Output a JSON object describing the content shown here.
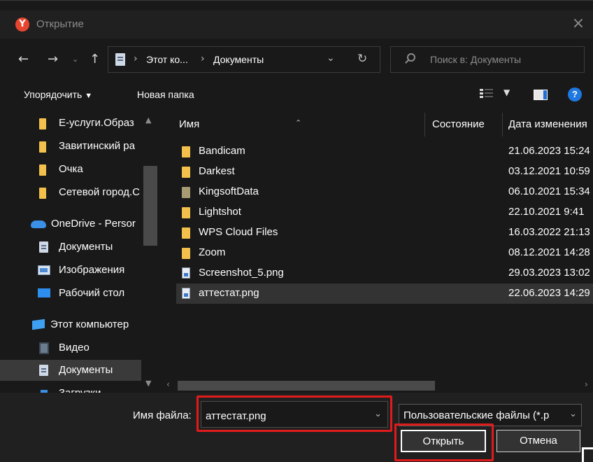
{
  "window": {
    "title": "Открытие",
    "app_icon": "yandex-browser-icon"
  },
  "address": {
    "crumbs": [
      "Этот ко...",
      "Документы"
    ]
  },
  "search": {
    "placeholder": "Поиск в: Документы"
  },
  "toolbar": {
    "organize_label": "Упорядочить",
    "new_folder_label": "Новая папка"
  },
  "sidebar": {
    "items": [
      {
        "label": "Е-услуги.Образ",
        "icon": "folder"
      },
      {
        "label": "Завитинский ра",
        "icon": "folder"
      },
      {
        "label": "Очка",
        "icon": "folder"
      },
      {
        "label": "Сетевой город.С",
        "icon": "folder"
      },
      {
        "label": "OneDrive - Persor",
        "icon": "onedrive"
      },
      {
        "label": "Документы",
        "icon": "documents"
      },
      {
        "label": "Изображения",
        "icon": "pictures"
      },
      {
        "label": "Рабочий стол",
        "icon": "desktop"
      },
      {
        "label": "Этот компьютер",
        "icon": "computer"
      },
      {
        "label": "Видео",
        "icon": "video"
      },
      {
        "label": "Документы",
        "icon": "documents",
        "selected": true
      },
      {
        "label": "Загрузки",
        "icon": "downloads"
      }
    ]
  },
  "columns": {
    "name": "Имя",
    "status": "Состояние",
    "date": "Дата изменения"
  },
  "files": [
    {
      "name": "Bandicam",
      "date": "21.06.2023 15:24",
      "type": "folder"
    },
    {
      "name": "Darkest",
      "date": "03.12.2021 10:59",
      "type": "folder"
    },
    {
      "name": "KingsoftData",
      "date": "06.10.2021 15:34",
      "type": "folder"
    },
    {
      "name": "Lightshot",
      "date": "22.10.2021 9:41",
      "type": "folder"
    },
    {
      "name": "WPS Cloud Files",
      "date": "16.03.2022 21:13",
      "type": "folder"
    },
    {
      "name": "Zoom",
      "date": "08.12.2021 14:28",
      "type": "folder"
    },
    {
      "name": "Screenshot_5.png",
      "date": "29.03.2023 13:02",
      "type": "png"
    },
    {
      "name": "аттестат.png",
      "date": "22.06.2023 14:29",
      "type": "png",
      "selected": true
    }
  ],
  "footer": {
    "filename_label": "Имя файла:",
    "filename_value": "аттестат.png",
    "filetype_value": "Пользовательские файлы (*.p",
    "open_label": "Открыть",
    "cancel_label": "Отмена"
  },
  "colors": {
    "highlight": "#e11b1b",
    "folder": "#f3c14b",
    "background": "#191919"
  }
}
